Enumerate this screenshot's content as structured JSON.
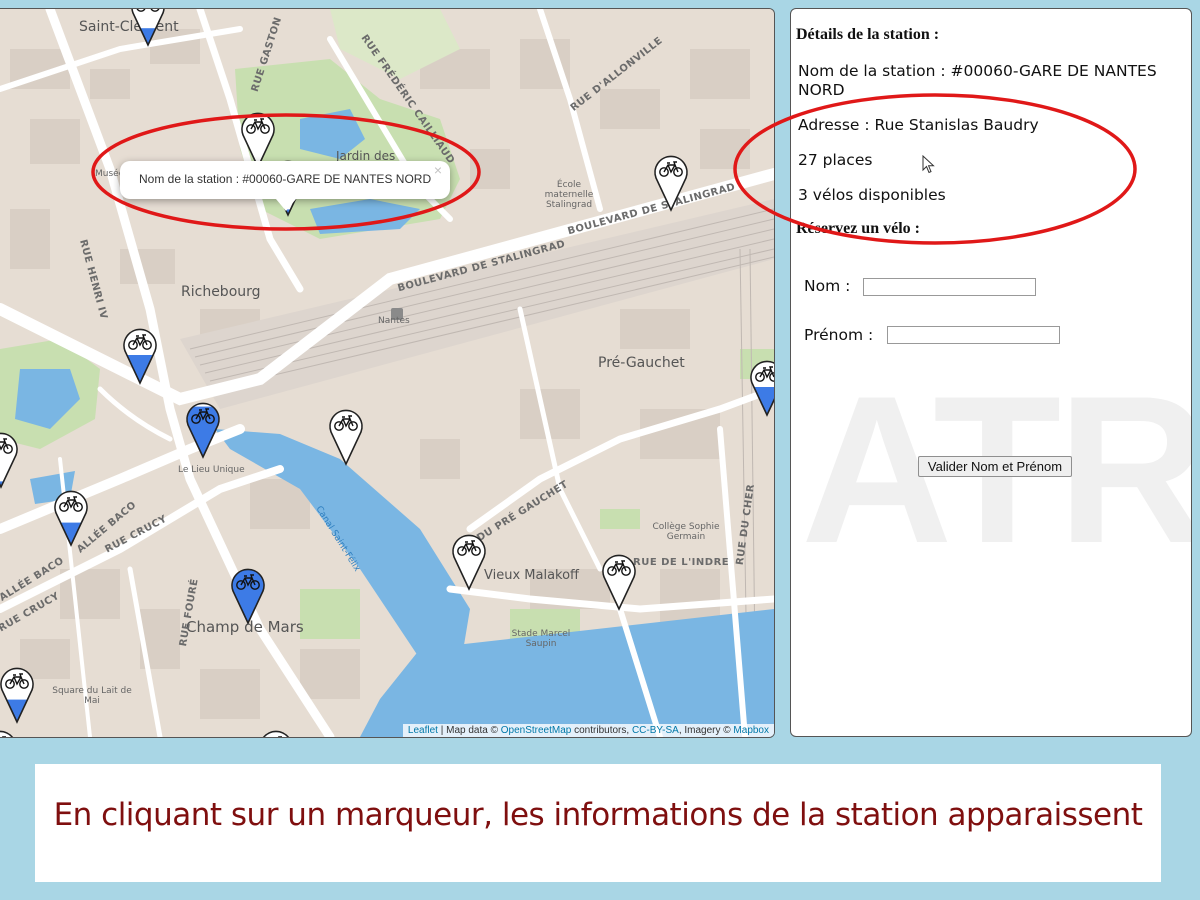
{
  "map": {
    "place_labels": {
      "saint_clement": "Saint-Clément",
      "richebourg": "Richebourg",
      "nantes": "Nantes",
      "pre_gauchet": "Pré-Gauchet",
      "le_lieu_unique": "Le Lieu Unique",
      "vieux_malakoff": "Vieux Malakoff",
      "champ_de_mars": "Champ de Mars",
      "jardin_des": "Jardin des",
      "musee": "Musée",
      "ecole_maternelle": "École maternelle Stalingrad",
      "college": "Collège Sophie Germain",
      "stade": "Stade Marcel Saupin",
      "square": "Square du Lait de Mai",
      "canal": "Canal Saint-Félix"
    },
    "street_labels": {
      "bd_stalingrad_1": "BOULEVARD DE STALINGRAD",
      "bd_stalingrad_2": "BOULEVARD DE STALINGRAD",
      "rue_frederic": "RUE FRÉDÉRIC CAILLIAUD",
      "rue_allonville": "RUE D'ALLONVILLE",
      "rue_gaston": "RUE GASTON",
      "rue_henri": "RUE HENRI IV",
      "allee_baco_1": "ALLÉE BACO",
      "allee_baco_2": "ALLÉE BACO",
      "rue_crucy_1": "RUE CRUCY",
      "rue_crucy_2": "RUE CRUCY",
      "rue_fouré": "RUE FOURÉ",
      "pre_gauchet_rue": "DU PRÉ GAUCHET",
      "rue_indre": "RUE DE L'INDRE",
      "rue_cher": "RUE DU CHER"
    },
    "popup": {
      "text": "Nom de la station : #00060-GARE DE NANTES NORD",
      "close": "×"
    },
    "attribution": {
      "leaflet": "Leaflet",
      "sep1": " | Map data © ",
      "osm": "OpenStreetMap",
      "contrib": " contributors, ",
      "license": "CC-BY-SA",
      "imagery": ", Imagery © ",
      "mapbox": "Mapbox"
    },
    "markers": [
      {
        "id": "marker-1",
        "fill": 0.3
      },
      {
        "id": "marker-2",
        "fill": 0.1
      },
      {
        "id": "marker-3",
        "fill": 0.1
      },
      {
        "id": "marker-4",
        "fill": 0.5
      },
      {
        "id": "marker-5",
        "fill": 0.1
      },
      {
        "id": "marker-6",
        "fill": 0.9
      },
      {
        "id": "marker-7",
        "fill": 0.0
      },
      {
        "id": "marker-8",
        "fill": 0.4
      },
      {
        "id": "marker-9",
        "fill": 0.0
      },
      {
        "id": "marker-10",
        "fill": 0.4
      },
      {
        "id": "marker-11",
        "fill": 0.0
      },
      {
        "id": "marker-12",
        "fill": 0.0
      },
      {
        "id": "marker-13",
        "fill": 0.95
      },
      {
        "id": "marker-14",
        "fill": 0.5
      },
      {
        "id": "marker-15",
        "fill": 0.0
      },
      {
        "id": "marker-16",
        "fill": 0.1
      }
    ],
    "colors": {
      "marker_fill": "#3d7be6",
      "water": "#7ab6e3",
      "park": "#c8dfb0"
    }
  },
  "panel": {
    "details_title": "Détails de la station :",
    "station_name": "Nom de la station : #00060-GARE DE NANTES NORD",
    "address": "Adresse : Rue Stanislas Baudry",
    "places": "27 places",
    "bikes": "3 vélos disponibles",
    "reserve_title": "Réservez un vélo :",
    "nom_label": "Nom :",
    "prenom_label": "Prénom :",
    "nom_value": "",
    "prenom_value": "",
    "validate_label": "Valider Nom et Prénom",
    "watermark": "ATRION"
  },
  "caption": {
    "text": "En cliquant sur un marqueur, les informations de la station apparaissent"
  }
}
